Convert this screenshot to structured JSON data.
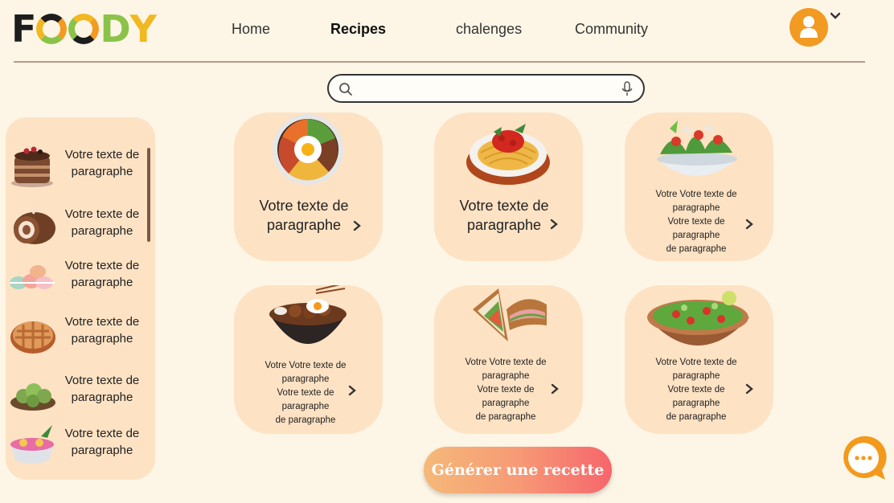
{
  "header": {
    "logo_text": "FOODY",
    "nav": [
      {
        "label": "Home",
        "active": false
      },
      {
        "label": "Recipes",
        "active": true
      },
      {
        "label": "chalenges",
        "active": false
      },
      {
        "label": "Community",
        "active": false
      }
    ],
    "avatar_icon": "user-icon",
    "avatar_color": "#f29a22"
  },
  "search": {
    "value": "",
    "placeholder": "",
    "icons": [
      "search-icon",
      "microphone-icon"
    ]
  },
  "sidebar": {
    "items": [
      {
        "label": "Votre texte de paragraphe",
        "icon": "chocolate-cake-icon"
      },
      {
        "label": "Votre texte de paragraphe",
        "icon": "swiss-roll-icon"
      },
      {
        "label": "Votre texte de paragraphe",
        "icon": "macarons-icon"
      },
      {
        "label": "Votre texte de paragraphe",
        "icon": "pie-icon"
      },
      {
        "label": "Votre texte de paragraphe",
        "icon": "green-dumplings-icon"
      },
      {
        "label": "Votre texte de paragraphe",
        "icon": "dessert-bowl-icon"
      }
    ]
  },
  "cards": [
    {
      "lines": [
        "Votre texte de",
        "paragraphe"
      ],
      "image": "bibimbap-icon"
    },
    {
      "lines": [
        "Votre texte de",
        "paragraphe"
      ],
      "image": "spaghetti-icon"
    },
    {
      "lines": [
        "Votre Votre texte de",
        "paragraphe",
        "Votre texte de",
        "paragraphe",
        "de paragraphe"
      ],
      "image": "salad-icon"
    },
    {
      "lines": [
        "Votre Votre texte de",
        "paragraphe",
        "Votre texte de",
        "paragraphe",
        "de paragraphe"
      ],
      "image": "rice-bowl-icon"
    },
    {
      "lines": [
        "Votre Votre texte de",
        "paragraphe",
        "Votre texte de",
        "paragraphe",
        "de paragraphe"
      ],
      "image": "sandwich-icon"
    },
    {
      "lines": [
        "Votre Votre texte de",
        "paragraphe",
        "Votre texte de",
        "paragraphe",
        "de paragraphe"
      ],
      "image": "vegetable-salad-icon"
    }
  ],
  "generate_button": {
    "label": "Générer une recette"
  },
  "chat": {
    "icon": "chat-bubble-icon"
  },
  "colors": {
    "background": "#fdf6e6",
    "card": "#fde2c4",
    "accent": "#f29a22",
    "button_gradient": [
      "#f5b978",
      "#f6666c"
    ]
  }
}
